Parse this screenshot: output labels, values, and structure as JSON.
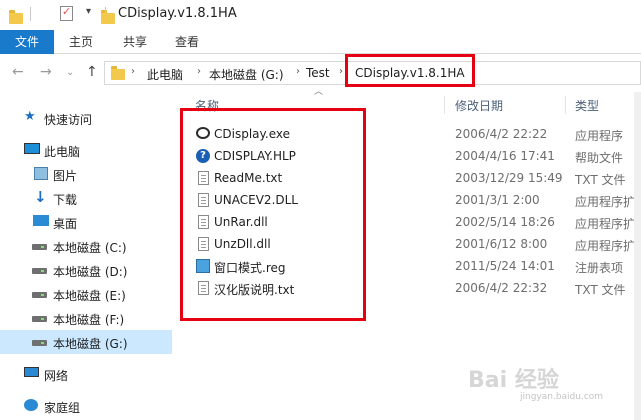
{
  "window": {
    "title": "CDisplay.v1.8.1HA"
  },
  "ribbon": {
    "tabs": [
      "文件",
      "主页",
      "共享",
      "查看"
    ]
  },
  "address": {
    "crumbs": [
      "此电脑",
      "本地磁盘 (G:)",
      "Test",
      "CDisplay.v1.8.1HA"
    ]
  },
  "sidebar": {
    "items": [
      {
        "label": "快速访问",
        "icon": "star-icon"
      },
      {
        "label": "此电脑",
        "icon": "computer-icon"
      },
      {
        "label": "图片",
        "icon": "pictures-icon"
      },
      {
        "label": "下载",
        "icon": "download-icon"
      },
      {
        "label": "桌面",
        "icon": "desktop-icon"
      },
      {
        "label": "本地磁盘 (C:)",
        "icon": "drive-icon"
      },
      {
        "label": "本地磁盘 (D:)",
        "icon": "drive-icon"
      },
      {
        "label": "本地磁盘 (E:)",
        "icon": "drive-icon"
      },
      {
        "label": "本地磁盘 (F:)",
        "icon": "drive-icon"
      },
      {
        "label": "本地磁盘 (G:)",
        "icon": "drive-icon",
        "selected": true
      },
      {
        "label": "网络",
        "icon": "network-icon"
      },
      {
        "label": "家庭组",
        "icon": "homegroup-icon"
      }
    ]
  },
  "columns": {
    "name": "名称",
    "date": "修改日期",
    "type": "类型"
  },
  "files": [
    {
      "name": "CDisplay.exe",
      "date": "2006/4/2 22:22",
      "type": "应用程序",
      "icon": "exe-icon"
    },
    {
      "name": "CDISPLAY.HLP",
      "date": "2004/4/16 17:41",
      "type": "帮助文件",
      "icon": "help-icon"
    },
    {
      "name": "ReadMe.txt",
      "date": "2003/12/29 15:49",
      "type": "TXT 文件",
      "icon": "text-file-icon"
    },
    {
      "name": "UNACEV2.DLL",
      "date": "2001/3/1 2:00",
      "type": "应用程序扩展",
      "icon": "dll-icon"
    },
    {
      "name": "UnRar.dll",
      "date": "2002/5/14 18:26",
      "type": "应用程序扩展",
      "icon": "dll-icon"
    },
    {
      "name": "UnzDll.dll",
      "date": "2001/6/12 8:00",
      "type": "应用程序扩展",
      "icon": "dll-icon"
    },
    {
      "name": "窗口模式.reg",
      "date": "2011/5/24 14:01",
      "type": "注册表项",
      "icon": "registry-icon"
    },
    {
      "name": "汉化版说明.txt",
      "date": "2006/4/2 22:32",
      "type": "TXT 文件",
      "icon": "text-file-icon"
    }
  ],
  "watermark": {
    "main": "Bai 经验",
    "sub": "jingyan.baidu.com"
  },
  "colors": {
    "accent": "#1979ca",
    "highlight": "#e50012",
    "selected": "#cce8ff"
  }
}
